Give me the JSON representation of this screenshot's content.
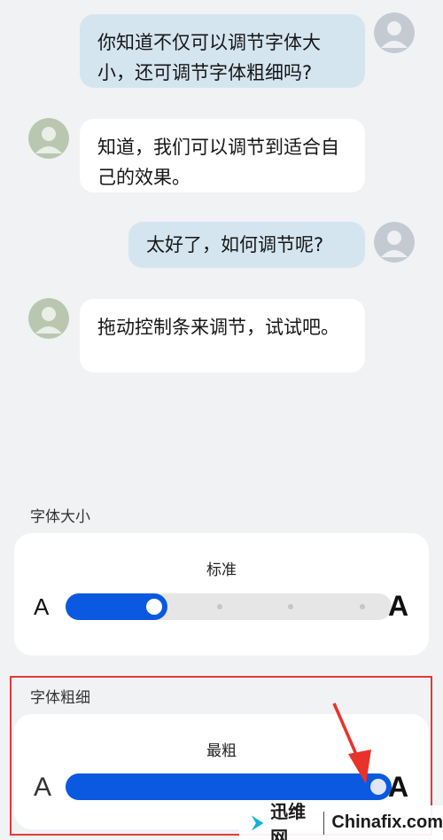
{
  "chat": {
    "messages": [
      {
        "from": "me",
        "text": "你知道不仅可以调节字体大小，还可调节字体粗细吗?"
      },
      {
        "from": "other",
        "text": "知道，我们可以调节到适合自己的效果。"
      },
      {
        "from": "me",
        "text": "太好了，如何调节呢?"
      },
      {
        "from": "other",
        "text": "拖动控制条来调节，试试吧。"
      }
    ]
  },
  "font_size": {
    "section_title": "字体大小",
    "level_label": "标准",
    "small_a": "A",
    "large_a": "A",
    "value_fraction": 0.25
  },
  "font_weight": {
    "section_title": "字体粗细",
    "level_label": "最粗",
    "small_a": "A",
    "large_a": "A",
    "value_fraction": 1.0
  },
  "watermark": {
    "brand_cn": "迅维网",
    "brand_en": "Chinafix.com"
  },
  "colors": {
    "accent": "#0a59e0",
    "highlight": "#e63a3a",
    "bubble_outgoing": "#d5e5f0",
    "bubble_incoming": "#ffffff"
  },
  "icons": [
    "user-avatar-icon",
    "red-arrow-annotation",
    "chinafix-logo-icon"
  ]
}
